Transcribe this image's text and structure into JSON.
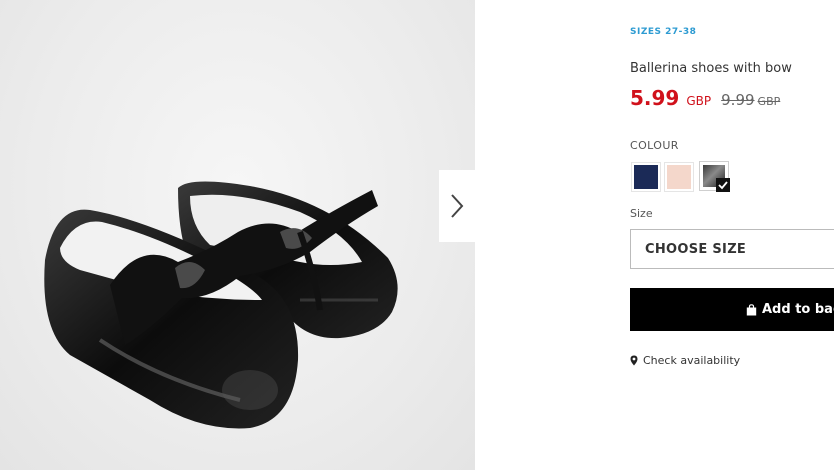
{
  "product": {
    "sizes_tag": "SIZES 27-38",
    "title": "Ballerina shoes with bow",
    "price": {
      "current": "5.99",
      "current_currency": "GBP",
      "old": "9.99",
      "old_currency": "GBP"
    }
  },
  "colour": {
    "label": "COLOUR",
    "swatches": [
      {
        "name": "navy",
        "color": "#1b2a57",
        "selected": false
      },
      {
        "name": "pink",
        "color": "#f4d7cb",
        "selected": false
      },
      {
        "name": "black",
        "color": "#1d1d1d",
        "selected": true
      }
    ]
  },
  "size": {
    "label": "Size",
    "placeholder": "CHOOSE SIZE"
  },
  "actions": {
    "add_to_bag": "Add to bag",
    "check_availability": "Check availability"
  },
  "gallery": {
    "image": "black patent ballerina shoes with bow",
    "next_icon": "chevron-right-icon"
  }
}
